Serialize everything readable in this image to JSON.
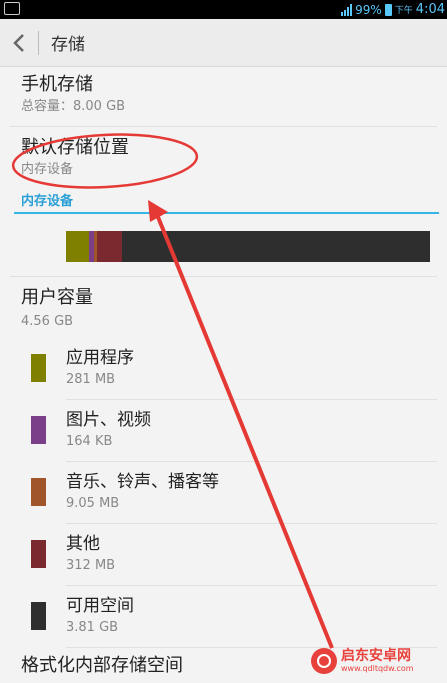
{
  "status_bar": {
    "battery": "99%",
    "ampm": "下午",
    "time": "4:04"
  },
  "header": {
    "back_icon": "chevron-left-icon",
    "title": "存储"
  },
  "phone_storage": {
    "title": "手机存储",
    "total": "总容量：8.00 GB"
  },
  "default_location": {
    "title": "默认存储位置",
    "value": "内存设备"
  },
  "tab": {
    "label": "内存设备"
  },
  "usage_bar": {
    "segments": [
      {
        "name": "apps",
        "fraction": 0.062,
        "color": "#808000"
      },
      {
        "name": "pictures",
        "fraction": 0.014,
        "color": "#7b3f8a"
      },
      {
        "name": "music",
        "fraction": 0.01,
        "color": "#a0552a"
      },
      {
        "name": "other",
        "fraction": 0.068,
        "color": "#7a2a2f"
      },
      {
        "name": "free",
        "fraction": 0.846,
        "color": "#2e2e2e"
      }
    ]
  },
  "user_capacity": {
    "title": "用户容量",
    "value": "4.56 GB"
  },
  "categories": [
    {
      "label": "应用程序",
      "size": "281 MB",
      "color": "#808000"
    },
    {
      "label": "图片、视频",
      "size": "164 KB",
      "color": "#7b3f8a"
    },
    {
      "label": "音乐、铃声、播客等",
      "size": "9.05 MB",
      "color": "#a0552a"
    },
    {
      "label": "其他",
      "size": "312 MB",
      "color": "#7a2a2f"
    },
    {
      "label": "可用空间",
      "size": "3.81 GB",
      "color": "#2e2e2e"
    }
  ],
  "format": {
    "title": "格式化内部存储空间"
  },
  "watermark": {
    "main": "启东安卓网",
    "sub": "www.qdltqdw.com"
  },
  "colors": {
    "accent": "#33b5e5",
    "annotation": "#e53935"
  }
}
